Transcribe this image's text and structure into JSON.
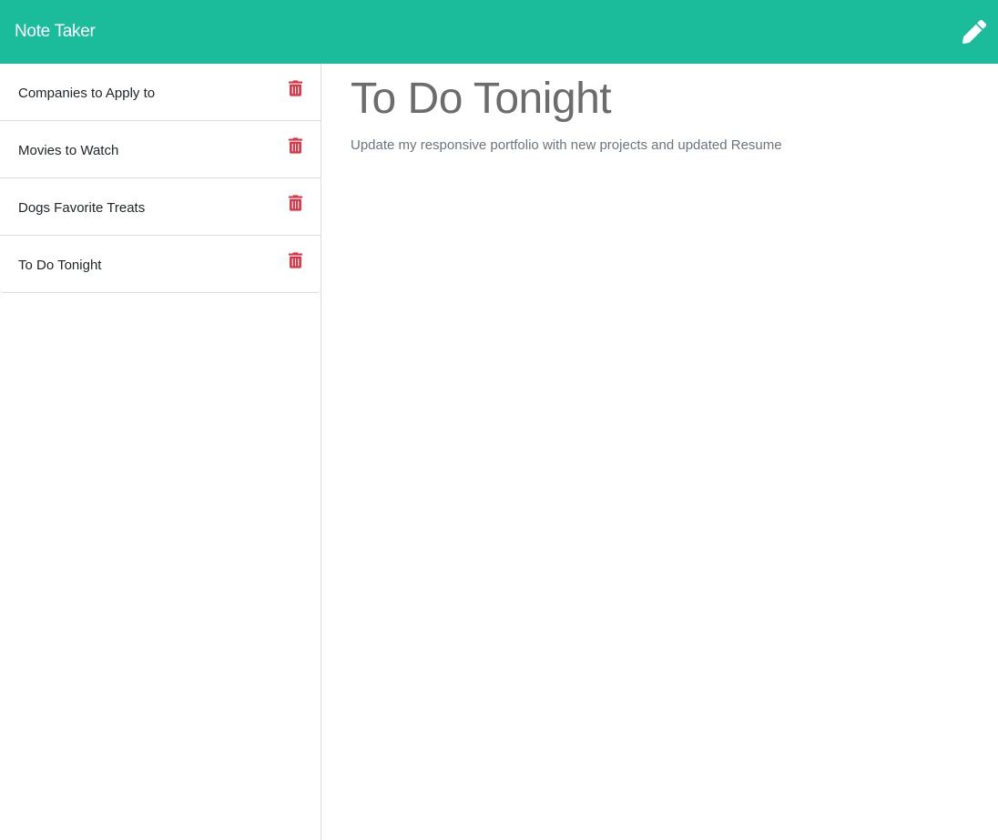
{
  "app": {
    "title": "Note Taker",
    "new_note_icon": "pencil-icon"
  },
  "colors": {
    "navbar": "#1abc9c",
    "delete": "#dc3545",
    "heading": "#6c6c6c"
  },
  "notes": [
    {
      "title": "Companies to Apply to",
      "delete_icon": "trash-icon"
    },
    {
      "title": "Movies to Watch",
      "delete_icon": "trash-icon"
    },
    {
      "title": "Dogs Favorite Treats",
      "delete_icon": "trash-icon"
    },
    {
      "title": "To Do Tonight",
      "delete_icon": "trash-icon"
    }
  ],
  "active_note": {
    "title": "To Do Tonight",
    "text": "Update my responsive portfolio with new projects and updated Resume"
  }
}
